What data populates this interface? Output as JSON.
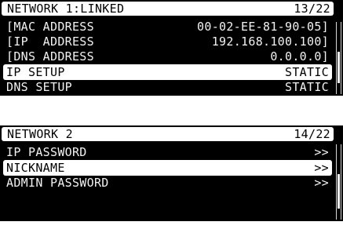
{
  "screens": [
    {
      "title": "NETWORK 1:LINKED",
      "page": "13/22",
      "rows": [
        {
          "label": "[MAC ADDRESS",
          "value": "00-02-EE-81-90-05]",
          "selected": false
        },
        {
          "label": "[IP  ADDRESS",
          "value": "192.168.100.100]",
          "selected": false
        },
        {
          "label": "[DNS ADDRESS",
          "value": "0.0.0.0]",
          "selected": false
        },
        {
          "label": "IP SETUP",
          "value": "STATIC",
          "selected": true
        },
        {
          "label": "DNS SETUP",
          "value": "STATIC",
          "selected": false
        }
      ]
    },
    {
      "title": "NETWORK 2",
      "page": "14/22",
      "rows": [
        {
          "label": "IP PASSWORD",
          "value": ">>",
          "selected": false
        },
        {
          "label": "NICKNAME",
          "value": ">>",
          "selected": true
        },
        {
          "label": "ADMIN PASSWORD",
          "value": ">>",
          "selected": false
        }
      ]
    }
  ],
  "colors": {
    "screen_background": "#000000",
    "text": "#f2f2f2",
    "highlight": "#ffffff",
    "highlight_text": "#000000"
  }
}
